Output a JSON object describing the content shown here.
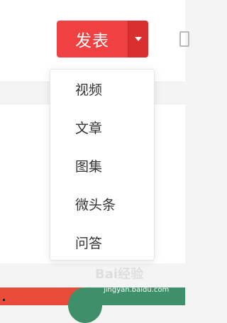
{
  "toolbar": {
    "publish_label": "发表"
  },
  "dropdown": {
    "items": [
      {
        "label": "视频"
      },
      {
        "label": "文章"
      },
      {
        "label": "图集"
      },
      {
        "label": "微头条"
      },
      {
        "label": "问答"
      }
    ]
  },
  "watermark": {
    "logo": "Bai经验",
    "url": "jingyan.baidu.com"
  },
  "colors": {
    "publish": "#f04142",
    "publish_toggle": "#d92f30"
  }
}
